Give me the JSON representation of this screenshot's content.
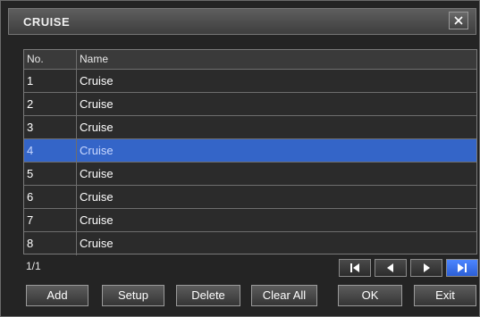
{
  "dialog": {
    "title": "CRUISE"
  },
  "table": {
    "headers": [
      "No.",
      "Name"
    ],
    "rows": [
      {
        "no": "1",
        "name": "Cruise"
      },
      {
        "no": "2",
        "name": "Cruise"
      },
      {
        "no": "3",
        "name": "Cruise"
      },
      {
        "no": "4",
        "name": "Cruise"
      },
      {
        "no": "5",
        "name": "Cruise"
      },
      {
        "no": "6",
        "name": "Cruise"
      },
      {
        "no": "7",
        "name": "Cruise"
      },
      {
        "no": "8",
        "name": "Cruise"
      }
    ],
    "selected_row": 4
  },
  "pager": {
    "text": "1/1"
  },
  "buttons": {
    "add": "Add",
    "setup": "Setup",
    "delete": "Delete",
    "clear_all": "Clear All",
    "ok": "OK",
    "exit": "Exit"
  },
  "icons": {
    "close": "close-icon",
    "first": "first-page-icon",
    "prev": "previous-page-icon",
    "next": "next-page-icon",
    "last": "last-page-icon"
  },
  "colors": {
    "selection": "#3465c8",
    "background": "#242424",
    "active_nav": "#2c5fd6"
  }
}
